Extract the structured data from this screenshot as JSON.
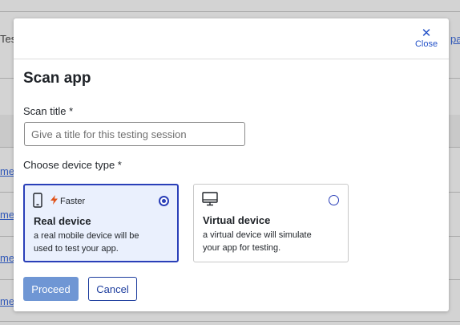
{
  "background": {
    "left_text": "Tes",
    "right_link": "pa",
    "row_links": [
      "me",
      "me",
      "me",
      "me"
    ]
  },
  "modal": {
    "close_label": "Close",
    "title": "Scan app",
    "scan_title_label": "Scan title *",
    "scan_title_placeholder": "Give a title for this testing session",
    "scan_title_value": "",
    "device_type_label": "Choose device type *",
    "options": [
      {
        "badge": "Faster",
        "name": "Real device",
        "description": "a real mobile device will be used to test your app.",
        "selected": true,
        "icon": "mobile-phone-icon"
      },
      {
        "badge": "",
        "name": "Virtual device",
        "description": "a virtual device will simulate your app for testing.",
        "selected": false,
        "icon": "desktop-monitor-icon"
      }
    ],
    "proceed_label": "Proceed",
    "cancel_label": "Cancel"
  },
  "colors": {
    "accent": "#2a3fb8",
    "primary_button": "#6f96d4",
    "selected_card_bg": "#eaf0fd",
    "link": "#2452c8",
    "badge_bolt": "#e0541c"
  }
}
